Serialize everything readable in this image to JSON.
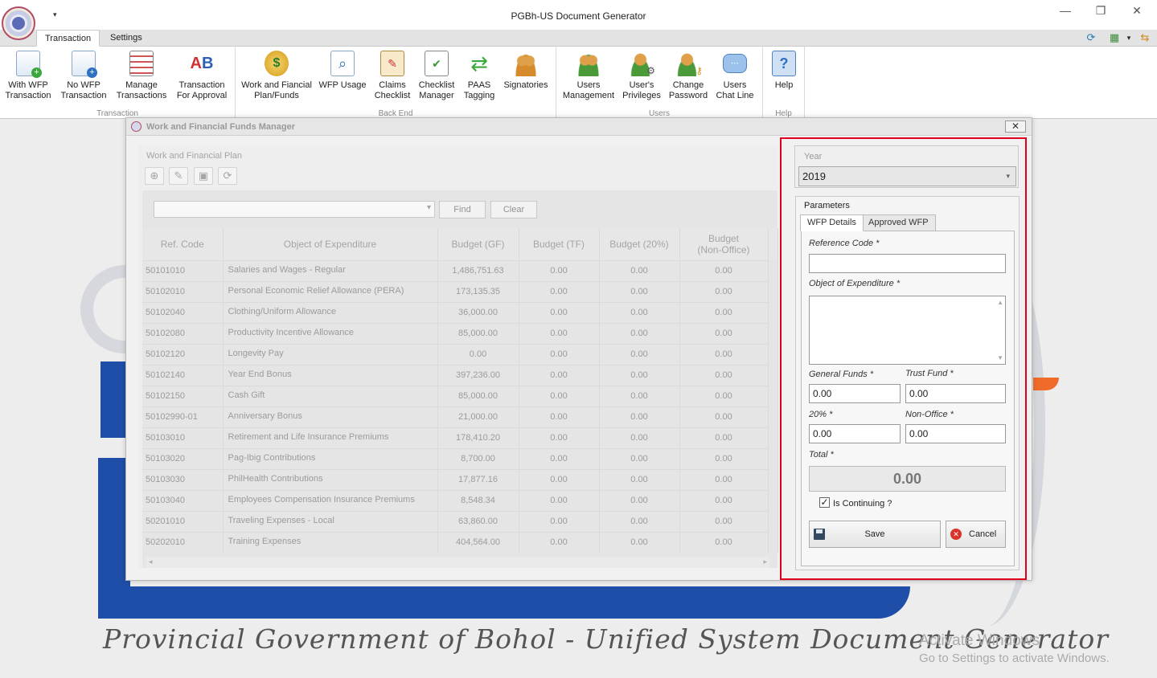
{
  "window": {
    "title": "PGBh-US Document Generator",
    "quick_access_arrow": "▾",
    "minimize": "—",
    "restore": "❐",
    "close": "✕"
  },
  "ribbon_tabs": [
    "Transaction",
    "Settings"
  ],
  "ribbon_groups": [
    {
      "label": "Transaction",
      "buttons": [
        {
          "label": "With WFP\nTransaction",
          "icon": "doc-add-icon"
        },
        {
          "label": "No WFP\nTransaction",
          "icon": "doc-add-blue-icon"
        },
        {
          "label": "Manage\nTransactions",
          "icon": "list-icon"
        },
        {
          "label": "Transaction\nFor Approval",
          "icon": "ab-approval-icon"
        }
      ]
    },
    {
      "label": "Back End",
      "buttons": [
        {
          "label": "Work and Fiancial\nPlan/Funds",
          "icon": "money-icon"
        },
        {
          "label": "WFP Usage",
          "icon": "doc-search-icon"
        },
        {
          "label": "Claims\nChecklist",
          "icon": "clipboard-icon"
        },
        {
          "label": "Checklist\nManager",
          "icon": "checklist-icon"
        },
        {
          "label": "PAAS\nTagging",
          "icon": "sync-arrows-icon"
        },
        {
          "label": "Signatories",
          "icon": "group-icon"
        }
      ]
    },
    {
      "label": "Users",
      "buttons": [
        {
          "label": "Users\nManagement",
          "icon": "users-icon"
        },
        {
          "label": "User's\nPrivileges",
          "icon": "user-gear-icon"
        },
        {
          "label": "Change\nPassword",
          "icon": "user-key-icon"
        },
        {
          "label": "Users\nChat Line",
          "icon": "chat-icon"
        }
      ]
    },
    {
      "label": "Help",
      "buttons": [
        {
          "label": "Help",
          "icon": "help-icon"
        }
      ]
    }
  ],
  "background": {
    "tagline": "Provincial Government of Bohol - Unified System Document Generator",
    "activate_line1": "Activate Windows",
    "activate_line2": "Go to Settings to activate Windows."
  },
  "dialog": {
    "title": "Work and Financial Funds Manager",
    "close": "✕",
    "left_group_caption": "Work and Financial Plan",
    "toolbar": [
      {
        "name": "add-icon",
        "glyph": "⊕"
      },
      {
        "name": "edit-icon",
        "glyph": "✎"
      },
      {
        "name": "delete-icon",
        "glyph": "▣"
      },
      {
        "name": "refresh-icon",
        "glyph": "⟳"
      }
    ],
    "search": {
      "value": "",
      "find_label": "Find",
      "clear_label": "Clear"
    },
    "columns": [
      "Ref. Code",
      "Object of Expenditure",
      "Budget (GF)",
      "Budget (TF)",
      "Budget (20%)",
      "Budget\n(Non-Office)"
    ],
    "rows": [
      [
        "50101010",
        "Salaries and Wages - Regular",
        "1,486,751.63",
        "0.00",
        "0.00",
        "0.00"
      ],
      [
        "50102010",
        "Personal Economic Relief Allowance (PERA)",
        "173,135.35",
        "0.00",
        "0.00",
        "0.00"
      ],
      [
        "50102040",
        "Clothing/Uniform Allowance",
        "36,000.00",
        "0.00",
        "0.00",
        "0.00"
      ],
      [
        "50102080",
        "Productivity Incentive Allowance",
        "85,000.00",
        "0.00",
        "0.00",
        "0.00"
      ],
      [
        "50102120",
        "Longevity Pay",
        "0.00",
        "0.00",
        "0.00",
        "0.00"
      ],
      [
        "50102140",
        "Year End Bonus",
        "397,236.00",
        "0.00",
        "0.00",
        "0.00"
      ],
      [
        "50102150",
        "Cash Gift",
        "85,000.00",
        "0.00",
        "0.00",
        "0.00"
      ],
      [
        "50102990-01",
        "Anniversary Bonus",
        "21,000.00",
        "0.00",
        "0.00",
        "0.00"
      ],
      [
        "50103010",
        "Retirement and Life Insurance Premiums",
        "178,410.20",
        "0.00",
        "0.00",
        "0.00"
      ],
      [
        "50103020",
        "Pag-Ibig Contributions",
        "8,700.00",
        "0.00",
        "0.00",
        "0.00"
      ],
      [
        "50103030",
        "PhilHealth Contributions",
        "17,877.16",
        "0.00",
        "0.00",
        "0.00"
      ],
      [
        "50103040",
        "Employees Compensation Insurance Premiums",
        "8,548.34",
        "0.00",
        "0.00",
        "0.00"
      ],
      [
        "50201010",
        "Traveling Expenses - Local",
        "63,860.00",
        "0.00",
        "0.00",
        "0.00"
      ],
      [
        "50202010",
        "Training Expenses",
        "404,564.00",
        "0.00",
        "0.00",
        "0.00"
      ]
    ],
    "year": {
      "label": "Year",
      "value": "2019"
    },
    "parameters": {
      "title": "Parameters",
      "tabs": [
        "WFP Details",
        "Approved WFP"
      ],
      "reference_code_label": "Reference Code *",
      "reference_code_value": "",
      "object_label": "Object of Expenditure *",
      "object_value": "",
      "general_funds_label": "General Funds *",
      "general_funds_value": "0.00",
      "trust_fund_label": "Trust Fund *",
      "trust_fund_value": "0.00",
      "pct20_label": "20% *",
      "pct20_value": "0.00",
      "non_office_label": "Non-Office *",
      "non_office_value": "0.00",
      "total_label": "Total *",
      "total_value": "0.00",
      "is_continuing_label": "Is Continuing ?",
      "is_continuing": true,
      "save_label": "Save",
      "cancel_label": "Cancel"
    }
  },
  "colors": {
    "highlight": "#e0001b",
    "cancel_red": "#d9342b",
    "brand_blue": "#1f4ea8",
    "brand_orange": "#f06a2a"
  }
}
